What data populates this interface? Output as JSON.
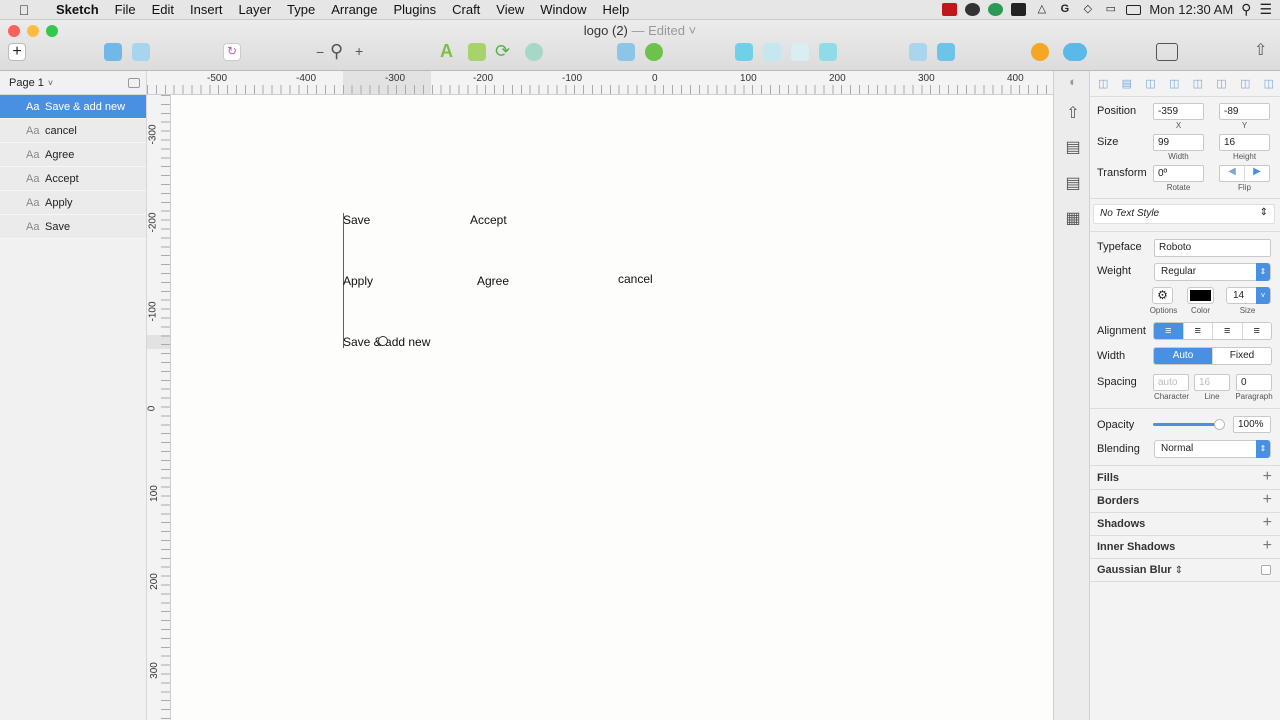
{
  "menubar": {
    "app": "Sketch",
    "items": [
      "File",
      "Edit",
      "Insert",
      "Layer",
      "Type",
      "Arrange",
      "Plugins",
      "Craft",
      "View",
      "Window",
      "Help"
    ],
    "clock": "Mon 12:30 AM"
  },
  "window": {
    "title": "logo (2)",
    "edited": "— Edited"
  },
  "layers": {
    "page": "Page 1",
    "items": [
      {
        "icon": "Aa",
        "label": "Save & add new"
      },
      {
        "icon": "Aa",
        "label": "cancel"
      },
      {
        "icon": "Aa",
        "label": "Agree"
      },
      {
        "icon": "Aa",
        "label": "Accept"
      },
      {
        "icon": "Aa",
        "label": "Apply"
      },
      {
        "icon": "Aa",
        "label": "Save"
      }
    ]
  },
  "rulers": {
    "h": [
      "-500",
      "-400",
      "-300",
      "-200",
      "-100",
      "0",
      "100",
      "200",
      "300",
      "400"
    ],
    "v": [
      "-300",
      "-200",
      "-100",
      "0",
      "100",
      "200",
      "300"
    ]
  },
  "canvas": {
    "save": "Save",
    "accept": "Accept",
    "apply": "Apply",
    "agree": "Agree",
    "cancel": "cancel",
    "save_add_new": "Save & add new"
  },
  "inspector": {
    "position_label": "Position",
    "x": "-359",
    "y": "-89",
    "x_label": "X",
    "y_label": "Y",
    "size_label": "Size",
    "width": "99",
    "height": "16",
    "width_label": "Width",
    "height_label": "Height",
    "transform_label": "Transform",
    "rotate": "0º",
    "rotate_label": "Rotate",
    "flip_label": "Flip",
    "text_style": "No Text Style",
    "typeface_label": "Typeface",
    "typeface": "Roboto",
    "weight_label": "Weight",
    "weight": "Regular",
    "options_label": "Options",
    "color_label": "Color",
    "size_sub": "Size",
    "font_size": "14",
    "alignment_label": "Alignment",
    "width_mode_label": "Width",
    "auto": "Auto",
    "fixed": "Fixed",
    "spacing_label": "Spacing",
    "char_placeholder": "auto",
    "line_placeholder": "16",
    "paragraph": "0",
    "char_label": "Character",
    "line_label": "Line",
    "paragraph_label": "Paragraph",
    "opacity_label": "Opacity",
    "opacity": "100%",
    "blending_label": "Blending",
    "blending": "Normal",
    "fills": "Fills",
    "borders": "Borders",
    "shadows": "Shadows",
    "inner_shadows": "Inner Shadows",
    "gaussian_blur": "Gaussian Blur"
  },
  "colors": {
    "accent": "#4a90e2",
    "text_color": "#000000"
  }
}
